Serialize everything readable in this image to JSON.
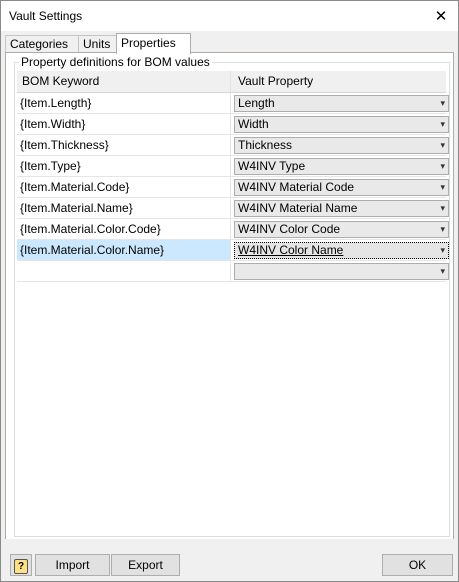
{
  "window": {
    "title": "Vault Settings"
  },
  "tabs": [
    {
      "label": "Categories",
      "active": false
    },
    {
      "label": "Units",
      "active": false
    },
    {
      "label": "Properties",
      "active": true
    }
  ],
  "group": {
    "title": "Property definitions for BOM values"
  },
  "grid": {
    "headers": [
      "BOM Keyword",
      "Vault Property"
    ],
    "rows": [
      {
        "keyword": "{Item.Length}",
        "property": "Length"
      },
      {
        "keyword": "{Item.Width}",
        "property": "Width"
      },
      {
        "keyword": "{Item.Thickness}",
        "property": "Thickness"
      },
      {
        "keyword": "{Item.Type}",
        "property": "W4INV Type"
      },
      {
        "keyword": "{Item.Material.Code}",
        "property": "W4INV Material Code"
      },
      {
        "keyword": "{Item.Material.Name}",
        "property": "W4INV Material Name"
      },
      {
        "keyword": "{Item.Material.Color.Code}",
        "property": "W4INV Color Code"
      },
      {
        "keyword": "{Item.Material.Color.Name}",
        "property": "W4INV Color Name",
        "selected": true
      },
      {
        "keyword": "",
        "property": ""
      }
    ]
  },
  "buttons": {
    "help": "?",
    "import": "Import",
    "export": "Export",
    "ok": "OK"
  },
  "icons": {
    "close": "close-icon",
    "chevron": "chevron-down-icon",
    "help": "help-icon"
  }
}
